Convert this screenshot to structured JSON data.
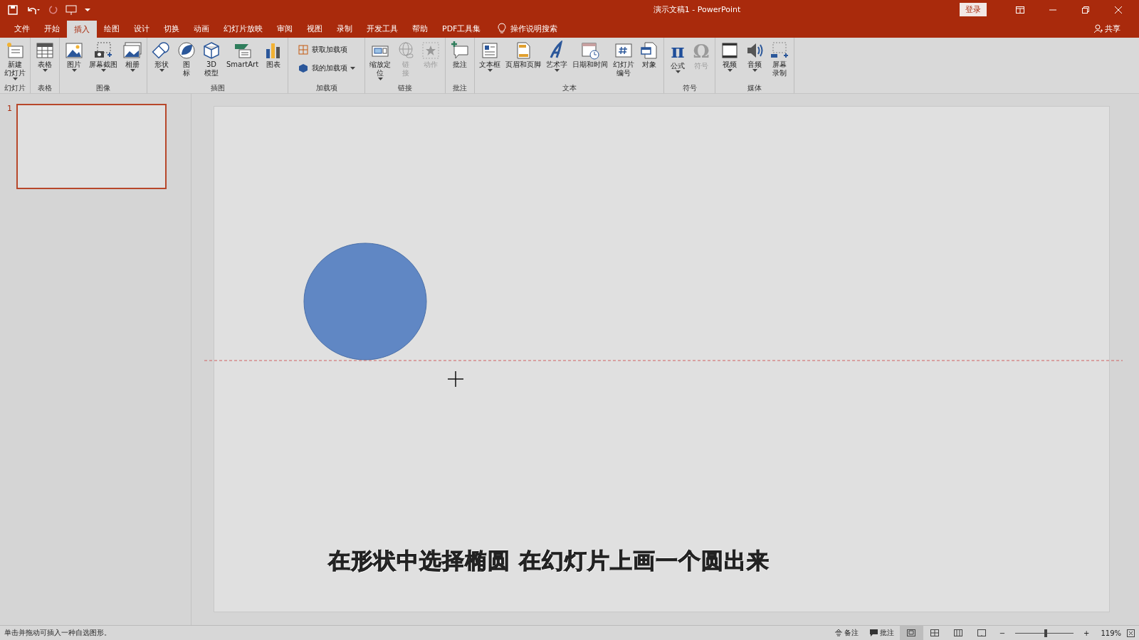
{
  "window": {
    "title": "演示文稿1  -  PowerPoint",
    "signin": "登录",
    "share": "共享"
  },
  "tabs": [
    {
      "label": "文件",
      "selected": false
    },
    {
      "label": "开始",
      "selected": false
    },
    {
      "label": "插入",
      "selected": true
    },
    {
      "label": "绘图",
      "selected": false
    },
    {
      "label": "设计",
      "selected": false
    },
    {
      "label": "切换",
      "selected": false
    },
    {
      "label": "动画",
      "selected": false
    },
    {
      "label": "幻灯片放映",
      "selected": false
    },
    {
      "label": "审阅",
      "selected": false
    },
    {
      "label": "视图",
      "selected": false
    },
    {
      "label": "录制",
      "selected": false
    },
    {
      "label": "开发工具",
      "selected": false
    },
    {
      "label": "帮助",
      "selected": false
    },
    {
      "label": "PDF工具集",
      "selected": false
    }
  ],
  "tell_me": {
    "placeholder": "操作说明搜索"
  },
  "ribbon": [
    {
      "label": "幻灯片",
      "buttons": [
        {
          "kind": "large",
          "lines": [
            "新建",
            "幻灯片"
          ],
          "dropdown": true,
          "disabled": false
        }
      ]
    },
    {
      "label": "表格",
      "buttons": [
        {
          "kind": "large",
          "label": "表格",
          "dropdown": true,
          "disabled": false
        }
      ]
    },
    {
      "label": "图像",
      "buttons": [
        {
          "kind": "large",
          "label": "图片",
          "dropdown": true,
          "disabled": false
        },
        {
          "kind": "large",
          "label": "屏幕截图",
          "dropdown": true,
          "disabled": false
        },
        {
          "kind": "large",
          "label": "相册",
          "dropdown": true,
          "disabled": false
        }
      ]
    },
    {
      "label": "插图",
      "buttons": [
        {
          "kind": "large",
          "label": "形状",
          "dropdown": true,
          "disabled": false
        },
        {
          "kind": "large",
          "lines": [
            "图",
            "标"
          ],
          "dropdown": false,
          "disabled": false
        },
        {
          "kind": "large",
          "lines": [
            "3D",
            "模型"
          ],
          "dropdown": false,
          "disabled": false
        },
        {
          "kind": "large",
          "label": "SmartArt",
          "dropdown": false,
          "disabled": false
        },
        {
          "kind": "large",
          "label": "图表",
          "dropdown": false,
          "disabled": false
        }
      ]
    },
    {
      "label": "加载项",
      "buttons": [
        {
          "kind": "small",
          "label": "获取加载项",
          "dropdown": false,
          "disabled": false
        },
        {
          "kind": "small",
          "label": "我的加载项",
          "dropdown": true,
          "disabled": false
        }
      ]
    },
    {
      "label": "链接",
      "buttons": [
        {
          "kind": "large",
          "lines": [
            "缩放定",
            "位"
          ],
          "dropdown": true,
          "disabled": false
        },
        {
          "kind": "large",
          "lines": [
            "链",
            "接"
          ],
          "dropdown": false,
          "disabled": true
        },
        {
          "kind": "large",
          "label": "动作",
          "dropdown": false,
          "disabled": true
        }
      ]
    },
    {
      "label": "批注",
      "buttons": [
        {
          "kind": "large",
          "label": "批注",
          "dropdown": false,
          "disabled": false
        }
      ]
    },
    {
      "label": "文本",
      "buttons": [
        {
          "kind": "large",
          "label": "文本框",
          "dropdown": true,
          "disabled": false
        },
        {
          "kind": "large",
          "label": "页眉和页脚",
          "dropdown": false,
          "disabled": false
        },
        {
          "kind": "large",
          "label": "艺术字",
          "dropdown": true,
          "disabled": false
        },
        {
          "kind": "large",
          "label": "日期和时间",
          "dropdown": false,
          "disabled": false
        },
        {
          "kind": "large",
          "lines": [
            "幻灯片",
            "编号"
          ],
          "dropdown": false,
          "disabled": false
        },
        {
          "kind": "large",
          "label": "对象",
          "dropdown": false,
          "disabled": false
        }
      ]
    },
    {
      "label": "符号",
      "buttons": [
        {
          "kind": "glyph",
          "glyph": "π",
          "label": "公式",
          "dropdown": true,
          "disabled": false
        },
        {
          "kind": "glyph",
          "glyph": "Ω",
          "label": "符号",
          "dropdown": false,
          "disabled": true
        }
      ]
    },
    {
      "label": "媒体",
      "buttons": [
        {
          "kind": "large",
          "label": "视频",
          "dropdown": true,
          "disabled": false
        },
        {
          "kind": "large",
          "label": "音频",
          "dropdown": true,
          "disabled": false
        },
        {
          "kind": "large",
          "lines": [
            "屏幕",
            "录制"
          ],
          "dropdown": false,
          "disabled": false
        }
      ]
    }
  ],
  "slides": [
    {
      "number": "1",
      "selected": true
    }
  ],
  "slide": {
    "caption": "在形状中选择椭圆  在幻灯片上画一个圆出来"
  },
  "status_bar": {
    "message": "单击并拖动可插入一种自选图形。",
    "notes": "备注",
    "comments": "批注",
    "views": [
      {
        "selected": true
      },
      {
        "selected": false
      },
      {
        "selected": false
      },
      {
        "selected": false
      }
    ],
    "zoom": {
      "out": "−",
      "in": "+",
      "level": 0.52,
      "reading": "119%"
    }
  }
}
